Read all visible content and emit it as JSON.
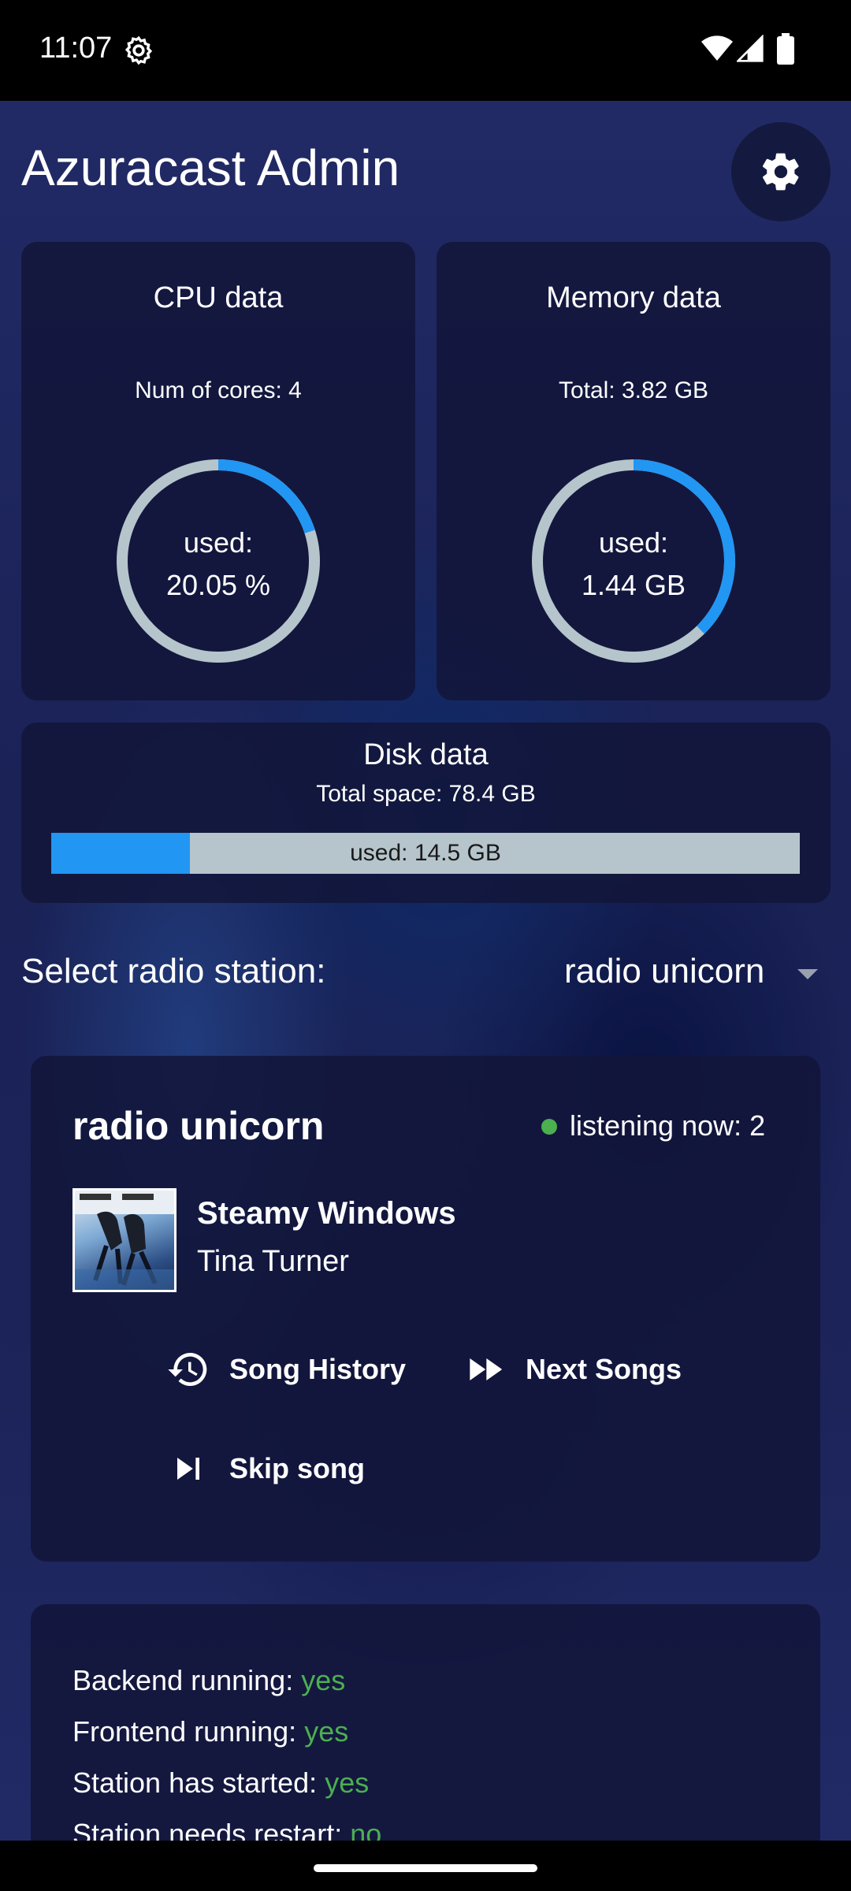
{
  "status_bar": {
    "time": "11:07",
    "icons": [
      "settings-icon",
      "wifi-icon",
      "signal-icon",
      "battery-icon"
    ]
  },
  "header": {
    "title": "Azuracast Admin",
    "settings_icon": "gear-icon"
  },
  "cpu": {
    "title": "CPU data",
    "cores_text": "Num of cores: 4",
    "used_label": "used:",
    "used_value": "20.05 %",
    "used_fraction": 0.2005
  },
  "memory": {
    "title": "Memory data",
    "total_text": "Total: 3.82 GB",
    "used_label": "used:",
    "used_value": "1.44 GB",
    "used_fraction": 0.377
  },
  "disk": {
    "title": "Disk data",
    "total_text": "Total space: 78.4 GB",
    "used_text": "used: 14.5 GB",
    "used_fraction": 0.185
  },
  "station_select": {
    "label": "Select radio station:",
    "selected": "radio unicorn"
  },
  "station": {
    "name": "radio unicorn",
    "listeners_text": "listening now: 2",
    "now_playing": {
      "title": "Steamy Windows",
      "artist": "Tina Turner"
    },
    "actions": {
      "history": "Song History",
      "next": "Next Songs",
      "skip": "Skip song"
    }
  },
  "service_status": [
    {
      "label": "Backend running: ",
      "value": "yes"
    },
    {
      "label": "Frontend running: ",
      "value": "yes"
    },
    {
      "label": "Station has started: ",
      "value": "yes"
    },
    {
      "label": "Station needs restart: ",
      "value": "no"
    }
  ],
  "colors": {
    "accent": "#2196f3",
    "track": "#b5c5cb",
    "ok": "#4caf50",
    "background": "#1e2559",
    "card": "#12163a"
  }
}
